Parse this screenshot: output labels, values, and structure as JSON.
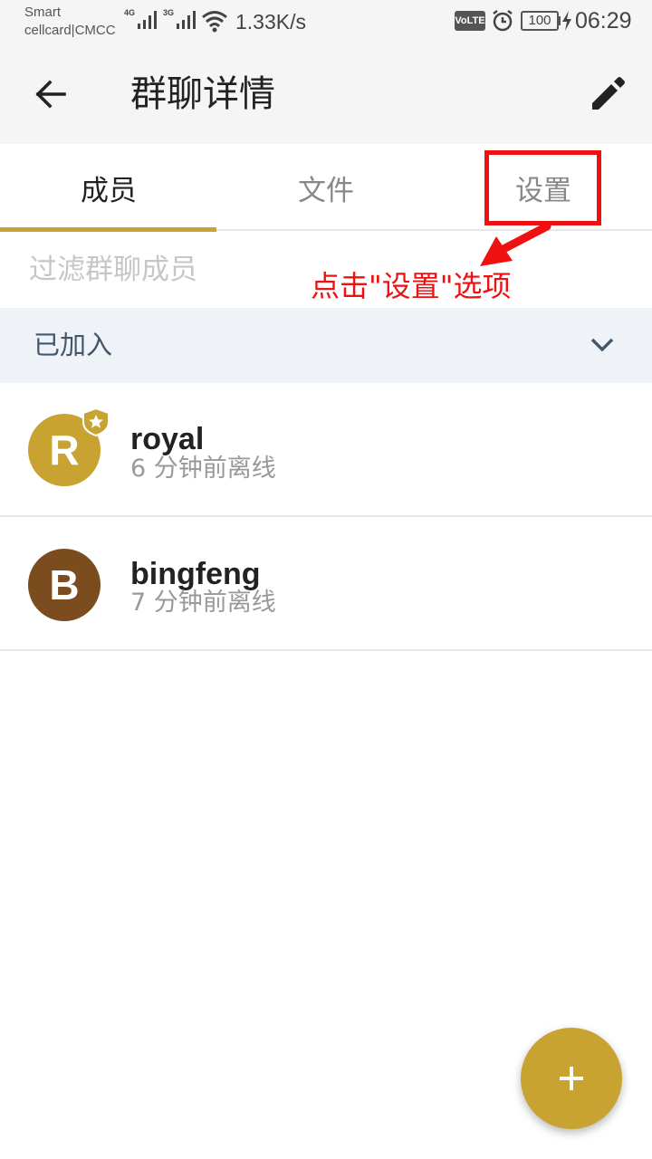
{
  "status_bar": {
    "carrier_line1": "Smart",
    "carrier_line2": "cellcard|CMCC",
    "network_1": "4G",
    "network_2": "3G",
    "speed": "1.33K/s",
    "volte": "VoLTE",
    "battery": "100",
    "time": "06:29",
    "icons": [
      "signal-icon",
      "wifi-icon",
      "alarm-icon",
      "battery-icon",
      "charging-icon"
    ]
  },
  "app_bar": {
    "title": "群聊详情",
    "back_icon": "arrow-left-icon",
    "edit_icon": "pencil-icon"
  },
  "tabs": [
    {
      "label": "成员",
      "active": true
    },
    {
      "label": "文件",
      "active": false
    },
    {
      "label": "设置",
      "active": false
    }
  ],
  "annotation": {
    "text": "点击\"设置\"选项",
    "color": "#ee1111"
  },
  "filter": {
    "placeholder": "过滤群聊成员",
    "value": ""
  },
  "section": {
    "label": "已加入",
    "icon": "chevron-down-icon"
  },
  "members": [
    {
      "initial": "R",
      "name": "royal",
      "status": "6 分钟前离线",
      "avatar_color": "#c9a332",
      "owner_badge": true
    },
    {
      "initial": "B",
      "name": "bingfeng",
      "status": "7 分钟前离线",
      "avatar_color": "#7a4c1e",
      "owner_badge": false
    }
  ],
  "fab": {
    "icon": "plus-icon",
    "color": "#c9a332"
  },
  "colors": {
    "accent": "#c9a332",
    "section_bg": "#eff3f7",
    "app_bar_bg": "#f5f5f5"
  }
}
